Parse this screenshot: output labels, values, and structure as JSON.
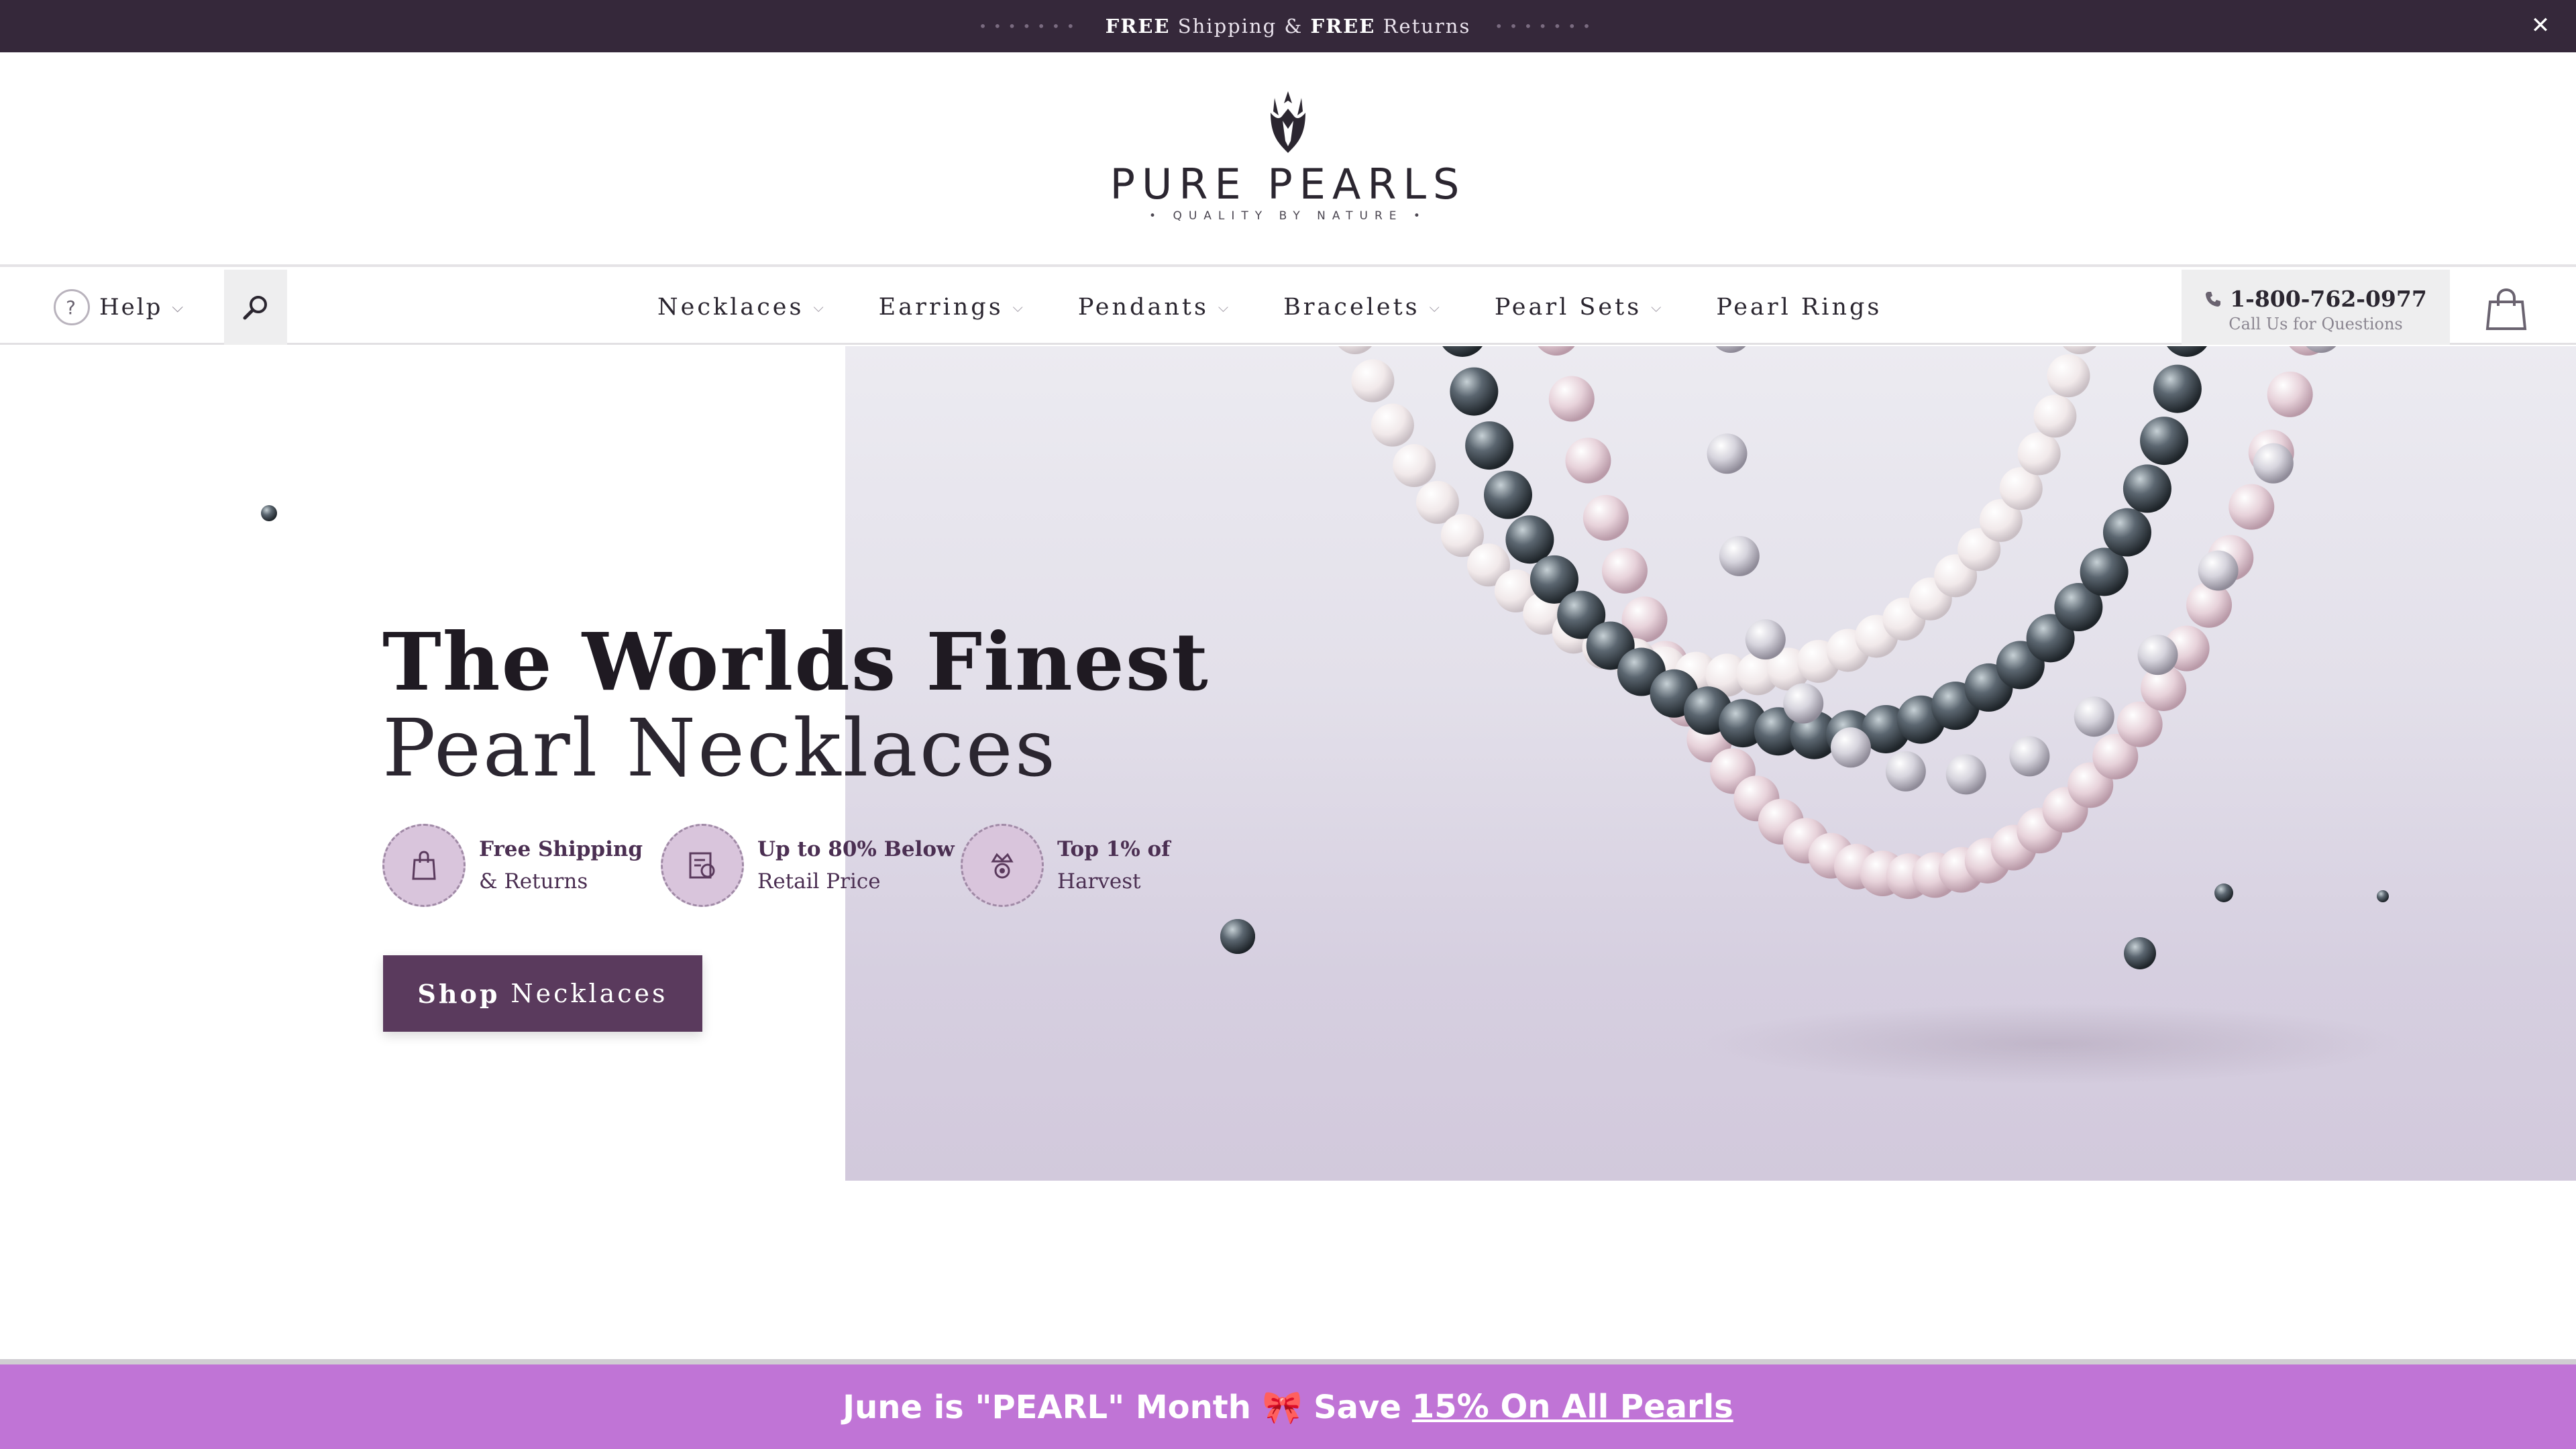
{
  "topbar": {
    "part1": "FREE",
    "part2": " Shipping & ",
    "part3": "FREE",
    "part4": " Returns",
    "close_glyph": "✕"
  },
  "logo": {
    "brand": "PURE PEARLS",
    "tagline": "• QUALITY BY NATURE •"
  },
  "nav": {
    "help_glyph": "?",
    "help_label": "Help",
    "chev": "⌵",
    "menu": [
      {
        "label": "Necklaces",
        "has_dropdown": true
      },
      {
        "label": "Earrings",
        "has_dropdown": true
      },
      {
        "label": "Pendants",
        "has_dropdown": true
      },
      {
        "label": "Bracelets",
        "has_dropdown": true
      },
      {
        "label": "Pearl Sets",
        "has_dropdown": true
      },
      {
        "label": "Pearl Rings",
        "has_dropdown": false
      }
    ],
    "phone": "1-800-762-0977",
    "phone_sub": "Call Us for Questions"
  },
  "hero": {
    "title_line1": "The Worlds Finest",
    "title_line2": "Pearl Necklaces",
    "features": [
      {
        "title": "Free Shipping",
        "sub": "& Returns",
        "icon": "shopping-bag-icon"
      },
      {
        "title": "Up to 80% Below",
        "sub": "Retail Price",
        "icon": "price-tag-icon"
      },
      {
        "title": "Top 1% of",
        "sub": "Harvest",
        "icon": "crown-pearl-icon"
      }
    ],
    "cta_bold": "Shop",
    "cta_rest": "Necklaces"
  },
  "banner": {
    "text": "June is \"PEARL\" Month 🎀 Save",
    "link": "15% On All Pearls"
  },
  "colors": {
    "topbar_bg": "#35283a",
    "brand_purple": "#5a3a5d",
    "banner_bg": "#c074d6"
  }
}
